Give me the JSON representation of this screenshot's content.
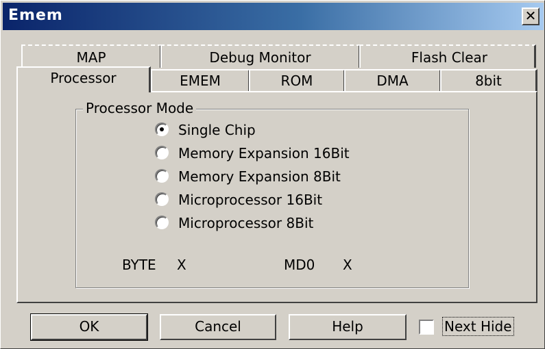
{
  "window": {
    "title": "Emem",
    "close_glyph": "✕"
  },
  "tabs_back": [
    "MAP",
    "Debug Monitor",
    "Flash Clear"
  ],
  "tabs_front": [
    "Processor",
    "EMEM",
    "ROM",
    "DMA",
    "8bit"
  ],
  "active_tab": "Processor",
  "group": {
    "label": "Processor Mode",
    "options": [
      {
        "label": "Single Chip",
        "selected": true
      },
      {
        "label": "Memory Expansion 16Bit",
        "selected": false
      },
      {
        "label": "Memory Expansion 8Bit",
        "selected": false
      },
      {
        "label": "Microprocessor 16Bit",
        "selected": false
      },
      {
        "label": "Microprocessor 8Bit",
        "selected": false
      }
    ],
    "byte_label": "BYTE",
    "byte_value": "X",
    "md0_label": "MD0",
    "md0_value": "X"
  },
  "buttons": {
    "ok": "OK",
    "cancel": "Cancel",
    "help": "Help"
  },
  "checkbox": {
    "label": "Next Hide",
    "checked": false
  },
  "colors": {
    "face": "#d4d0c8",
    "title_start": "#0a246a",
    "title_end": "#a6caf0"
  }
}
